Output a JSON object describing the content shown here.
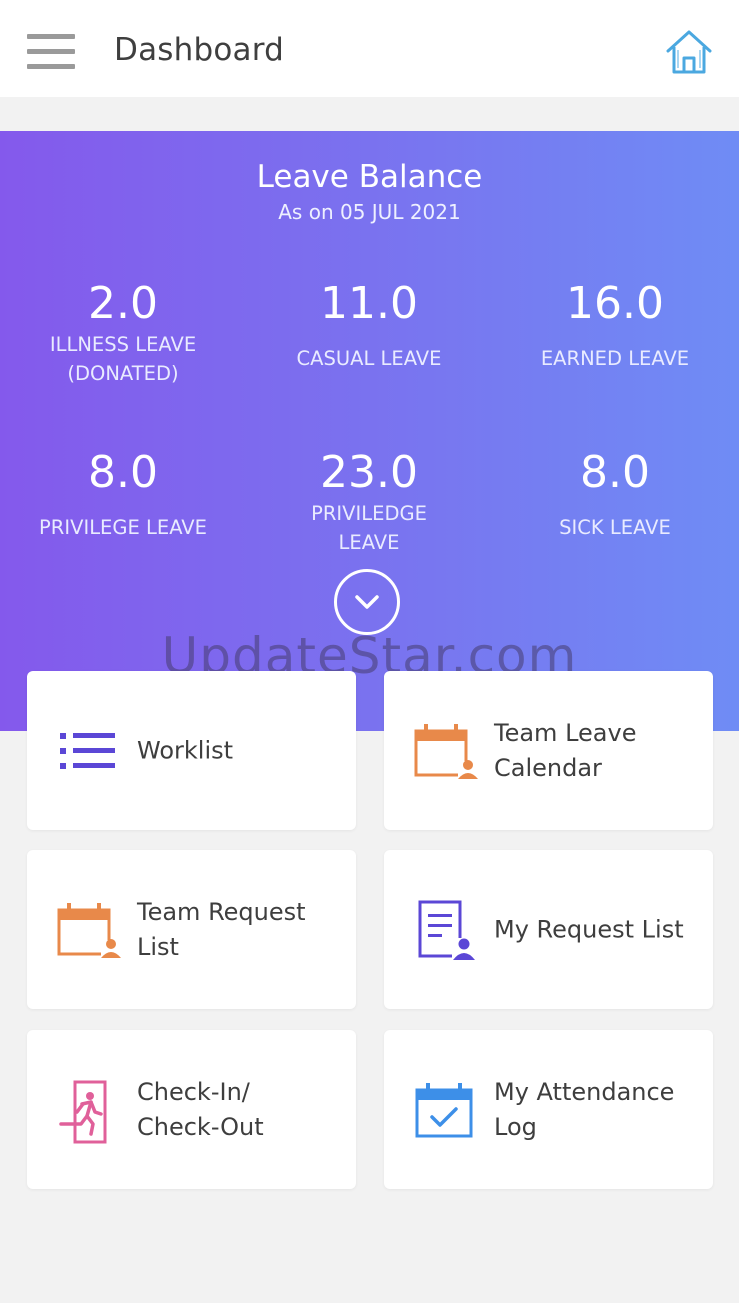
{
  "header": {
    "title": "Dashboard",
    "menu_icon": "hamburger-menu-icon",
    "home_icon": "home-icon"
  },
  "leave_balance": {
    "title": "Leave Balance",
    "as_on": "As on 05 JUL 2021",
    "items": [
      {
        "value": "2.0",
        "label": "ILLNESS LEAVE\n(DONATED)"
      },
      {
        "value": "11.0",
        "label": "CASUAL LEAVE"
      },
      {
        "value": "16.0",
        "label": "EARNED LEAVE"
      },
      {
        "value": "8.0",
        "label": "PRIVILEGE LEAVE"
      },
      {
        "value": "23.0",
        "label": "PRIVILEDGE\nLEAVE"
      },
      {
        "value": "8.0",
        "label": "SICK LEAVE"
      }
    ],
    "expand_icon": "chevron-down-icon"
  },
  "watermark": "UpdateStar.com",
  "tiles": [
    {
      "label": "Worklist",
      "icon": "list-icon"
    },
    {
      "label": "Team Leave\nCalendar",
      "icon": "calendar-person-icon"
    },
    {
      "label": "Team Request\nList",
      "icon": "calendar-person-icon"
    },
    {
      "label": "My Request List",
      "icon": "document-person-icon"
    },
    {
      "label": "Check-In/\nCheck-Out",
      "icon": "exit-door-icon"
    },
    {
      "label": "My Attendance\nLog",
      "icon": "calendar-check-icon"
    }
  ],
  "colors": {
    "banner_start": "#8459ec",
    "banner_end": "#6f8cf5",
    "purple_icon": "#5b47d6",
    "orange_icon": "#e8894a",
    "pink_icon": "#e0609a",
    "blue_icon": "#3d8fe8",
    "home_icon": "#4ba8e0"
  }
}
